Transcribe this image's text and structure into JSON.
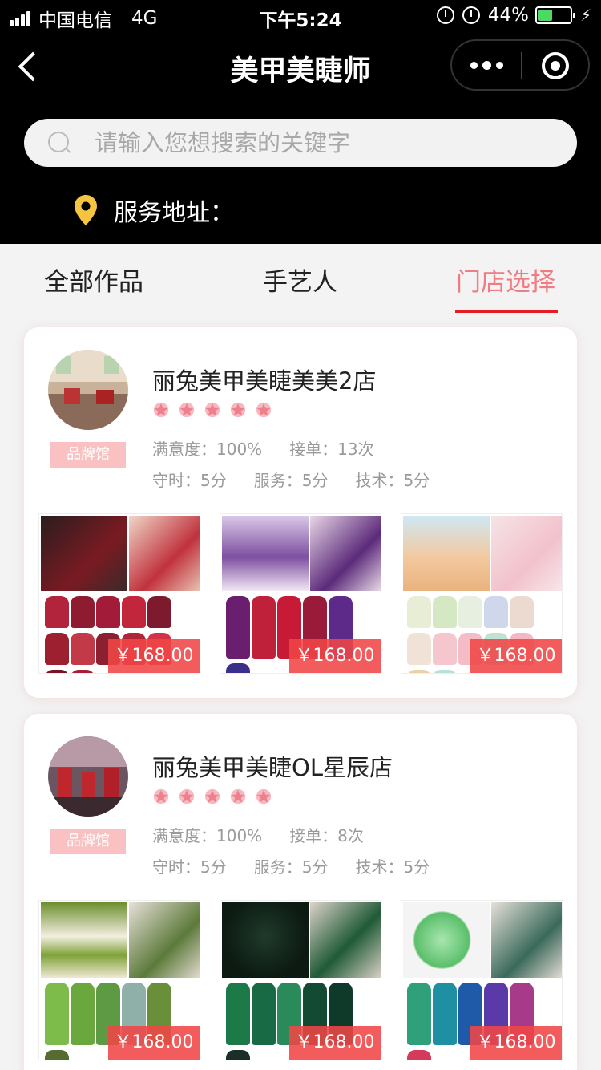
{
  "status_bar": {
    "carrier": "中国电信",
    "network": "4G",
    "time": "下午5:24",
    "battery_percent": "44%"
  },
  "nav": {
    "title": "美甲美睫师"
  },
  "search": {
    "placeholder": "请输入您想搜索的关键字"
  },
  "address": {
    "label": "服务地址："
  },
  "tabs": [
    {
      "label": "全部作品"
    },
    {
      "label": "手艺人"
    },
    {
      "label": "门店选择"
    }
  ],
  "colors": {
    "accent": "#e51c23",
    "active_tab": "#f07b82",
    "badge": "#f9c1c1",
    "star": "#f08c98",
    "price_bg": "#f04646"
  },
  "shops": [
    {
      "name": "丽兔美甲美睫美美2店",
      "badge": "品牌馆",
      "rating_stars": 5,
      "satisfaction": "满意度：100%",
      "orders": "接单：13次",
      "punctuality": "守时：5分",
      "service": "服务：5分",
      "skill": "技术：5分",
      "products": [
        {
          "price": "￥168.00"
        },
        {
          "price": "￥168.00"
        },
        {
          "price": "￥168.00"
        }
      ]
    },
    {
      "name": "丽兔美甲美睫OL星辰店",
      "badge": "品牌馆",
      "rating_stars": 5,
      "satisfaction": "满意度：100%",
      "orders": "接单：8次",
      "punctuality": "守时：5分",
      "service": "服务：5分",
      "skill": "技术：5分",
      "products": [
        {
          "price": "￥168.00"
        },
        {
          "price": "￥168.00"
        },
        {
          "price": "￥168.00"
        }
      ]
    }
  ]
}
